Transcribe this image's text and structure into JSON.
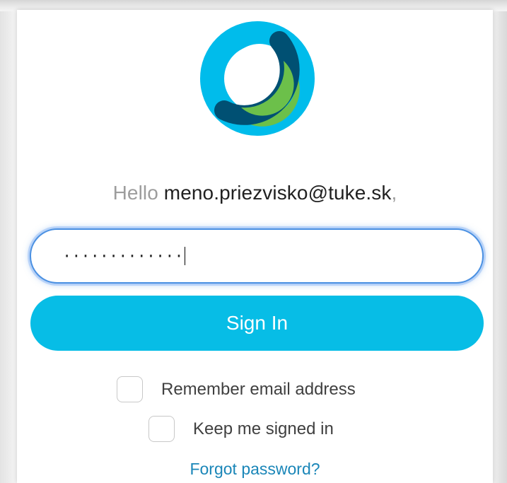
{
  "login": {
    "greeting_prefix": "Hello",
    "email": "meno.priezvisko@tuke.sk",
    "greeting_suffix": ",",
    "password_masked": "·············",
    "sign_in_label": "Sign In",
    "remember_email_label": "Remember email address",
    "keep_signed_in_label": "Keep me signed in",
    "forgot_password_label": "Forgot password?",
    "remember_email_checked": false,
    "keep_signed_in_checked": false
  },
  "colors": {
    "accent": "#07bde6",
    "link": "#1a86b8",
    "focus_ring": "#4a90e2",
    "logo_light_blue": "#00bceb",
    "logo_dark_blue": "#005073",
    "logo_green": "#6cc04a"
  },
  "icons": {
    "logo": "webex-logo"
  }
}
